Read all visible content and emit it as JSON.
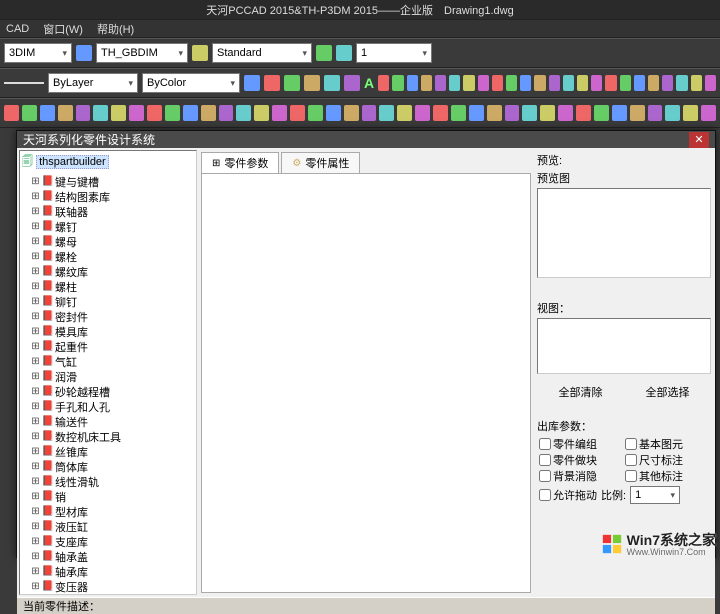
{
  "title": "天河PCCAD 2015&TH-P3DM 2015——企业版　Drawing1.dwg",
  "menu": {
    "cad": "CAD",
    "window": "窗口(W)",
    "help": "帮助(H)"
  },
  "toolbar1": {
    "dim": "3DIM",
    "gbdim": "TH_GBDIM",
    "standard": "Standard",
    "one": "1"
  },
  "toolbar2": {
    "bylayer": "ByLayer",
    "bycolor": "ByColor",
    "A": "A"
  },
  "dialog": {
    "title": "天河系列化零件设计系统",
    "root": "thspartbuilder",
    "tree": [
      "键与键槽",
      "结构图素库",
      "联轴器",
      "螺钉",
      "螺母",
      "螺栓",
      "螺纹库",
      "螺柱",
      "铆钉",
      "密封件",
      "模具库",
      "起重件",
      "气缸",
      "润滑",
      "砂轮越程槽",
      "手孔和人孔",
      "输送件",
      "数控机床工具",
      "丝锥库",
      "筒体库",
      "线性滑轨",
      "销",
      "型材库",
      "液压缸",
      "支座库",
      "轴承盖",
      "轴承库",
      "变压器"
    ],
    "tabs": {
      "params": "零件参数",
      "attrs": "零件属性"
    },
    "right": {
      "preview_label": "预览:",
      "preview_image": "预览图",
      "view_label": "视图：",
      "clear_all": "全部清除",
      "select_all": "全部选择",
      "out_params_label": "出库参数：",
      "checks": {
        "part_group": "零件编组",
        "basic_elem": "基本图元",
        "part_block": "零件做块",
        "dim_annot": "尺寸标注",
        "bg_erase": "背景消隐",
        "other_annot": "其他标注",
        "allow_drag": "允许拖动"
      },
      "ratio_label": "比例:",
      "ratio_value": "1"
    },
    "status": "当前零件描述："
  },
  "watermark": {
    "brand": "Win7系统之家",
    "url": "Www.Winwin7.Com"
  }
}
